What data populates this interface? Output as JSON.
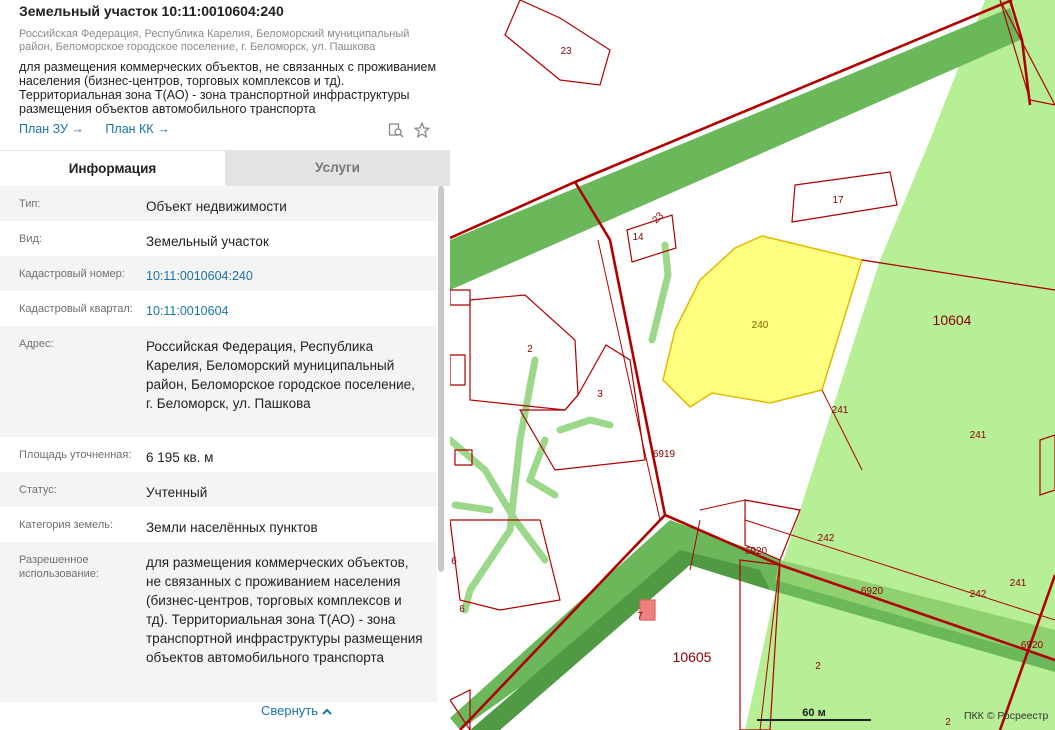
{
  "header": {
    "title": "Земельный участок 10:11:0010604:240",
    "address_short": "Российская Федерация, Республика Карелия, Беломорский муниципальный район, Беломорское городское поселение, г. Беломорск, ул. Пашкова",
    "description": "для размещения коммерческих объектов, не связанных с проживанием населения (бизнес-центров, торговых комплексов и тд). Территориальная зона Т(АО) - зона транспортной инфраструктуры размещения объектов автомобильного транспорта",
    "link_plan_zu": "План ЗУ →",
    "link_plan_kk": "План КК →"
  },
  "tabs": {
    "info": "Информация",
    "services": "Услуги"
  },
  "rows": {
    "type": {
      "label": "Тип:",
      "value": "Объект недвижимости"
    },
    "kind": {
      "label": "Вид:",
      "value": "Земельный участок"
    },
    "cad_num": {
      "label": "Кадастровый номер:",
      "value": "10:11:0010604:240"
    },
    "cad_block": {
      "label": "Кадастровый квартал:",
      "value": "10:11:0010604"
    },
    "address": {
      "label": "Адрес:",
      "value": "Российская Федерация, Республика Карелия, Беломорский муниципальный район, Беломорское городское поселение, г. Беломорск, ул. Пашкова"
    },
    "area": {
      "label": "Площадь уточненная:",
      "value": "6 195 кв. м"
    },
    "status": {
      "label": "Статус:",
      "value": "Учтенный"
    },
    "category": {
      "label": "Категория земель:",
      "value": "Земли населённых пунктов"
    },
    "permitted": {
      "label": "Разрешенное использование:",
      "value": "для размещения коммерческих объектов, не связанных с проживанием населения (бизнес-центров, торговых комплексов и тд). Территориальная зона Т(АО) - зона транспортной инфраструктуры размещения объектов автомобильного транспорта"
    }
  },
  "collapse_label": "Свернуть",
  "map": {
    "labels": {
      "p23": "23",
      "p17": "17",
      "p14": "14",
      "p23b": "23",
      "p240": "240",
      "q10604": "10604",
      "p2a": "2",
      "p3": "3",
      "p241a": "241",
      "p241b": "241",
      "p241c": "241",
      "p6919": "6919",
      "p242a": "242",
      "p242b": "242",
      "p6920a": "6920",
      "p6920b": "6920",
      "p6920c": "6920",
      "p6a": "6",
      "p6b": "6",
      "p7": "7",
      "q10605": "10605",
      "p2b": "2",
      "p2c": "2"
    },
    "scale_label": "60 м",
    "credit": "ПКК © Росреестр"
  },
  "colors": {
    "selected_parcel": "#ffff80",
    "boundary": "#b00000",
    "green_zone": "#b6ef96",
    "road_green": "#6ab85a",
    "link": "#1a73a8"
  }
}
